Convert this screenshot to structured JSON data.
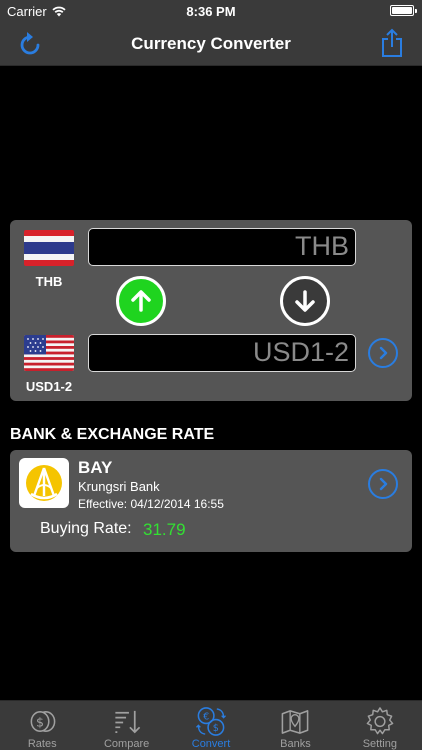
{
  "status_bar": {
    "carrier": "Carrier",
    "time": "8:36 PM"
  },
  "nav": {
    "title": "Currency Converter",
    "left_icon": "refresh-icon",
    "right_icon": "share-icon"
  },
  "converter": {
    "from": {
      "code": "THB",
      "field_text": "THB",
      "flag": "thailand-flag"
    },
    "to": {
      "code": "USD1-2",
      "field_text": "USD1-2",
      "flag": "usa-flag"
    },
    "up_button_icon": "arrow-up-icon",
    "down_button_icon": "arrow-down-icon"
  },
  "section_heading": "BANK & EXCHANGE RATE",
  "bank": {
    "code": "BAY",
    "name": "Krungsri Bank",
    "effective": "Effective: 04/12/2014 16:55",
    "buying_label": "Buying Rate:",
    "buying_value": "31.79"
  },
  "colors": {
    "accent_blue": "#2a7de0",
    "green": "#1fd41f",
    "panel": "#555555",
    "bar": "#3a3a3a",
    "logo_yellow": "#f5c400"
  },
  "tabs": [
    {
      "label": "Rates",
      "icon": "coins-icon",
      "active": false
    },
    {
      "label": "Compare",
      "icon": "sort-list-icon",
      "active": false
    },
    {
      "label": "Convert",
      "icon": "currency-exchange-icon",
      "active": true
    },
    {
      "label": "Banks",
      "icon": "map-icon",
      "active": false
    },
    {
      "label": "Setting",
      "icon": "gear-icon",
      "active": false
    }
  ]
}
